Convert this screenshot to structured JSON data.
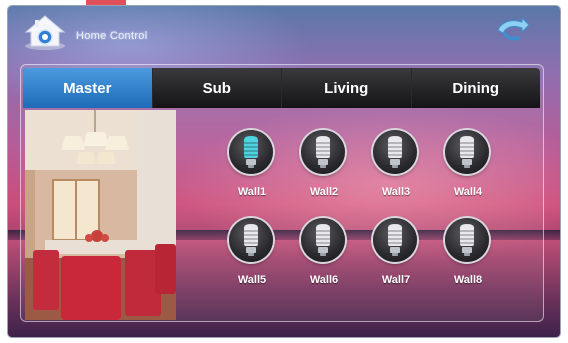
{
  "header": {
    "title": "Home Control",
    "home_icon": "home-icon",
    "back_icon": "return-arrow-icon"
  },
  "tabs": [
    {
      "label": "Master",
      "active": true
    },
    {
      "label": "Sub",
      "active": false
    },
    {
      "label": "Living",
      "active": false
    },
    {
      "label": "Dining",
      "active": false
    }
  ],
  "room_photo": {
    "icon": "dining-room-photo"
  },
  "lights": [
    {
      "label": "Wall1",
      "state": "on"
    },
    {
      "label": "Wall2",
      "state": "off"
    },
    {
      "label": "Wall3",
      "state": "off"
    },
    {
      "label": "Wall4",
      "state": "off"
    },
    {
      "label": "Wall5",
      "state": "off"
    },
    {
      "label": "Wall6",
      "state": "off"
    },
    {
      "label": "Wall7",
      "state": "off"
    },
    {
      "label": "Wall8",
      "state": "off"
    }
  ],
  "colors": {
    "active_tab": "#2f82d0",
    "bulb_on": "#4fd3e0",
    "bulb_off": "#e8e8ee"
  }
}
